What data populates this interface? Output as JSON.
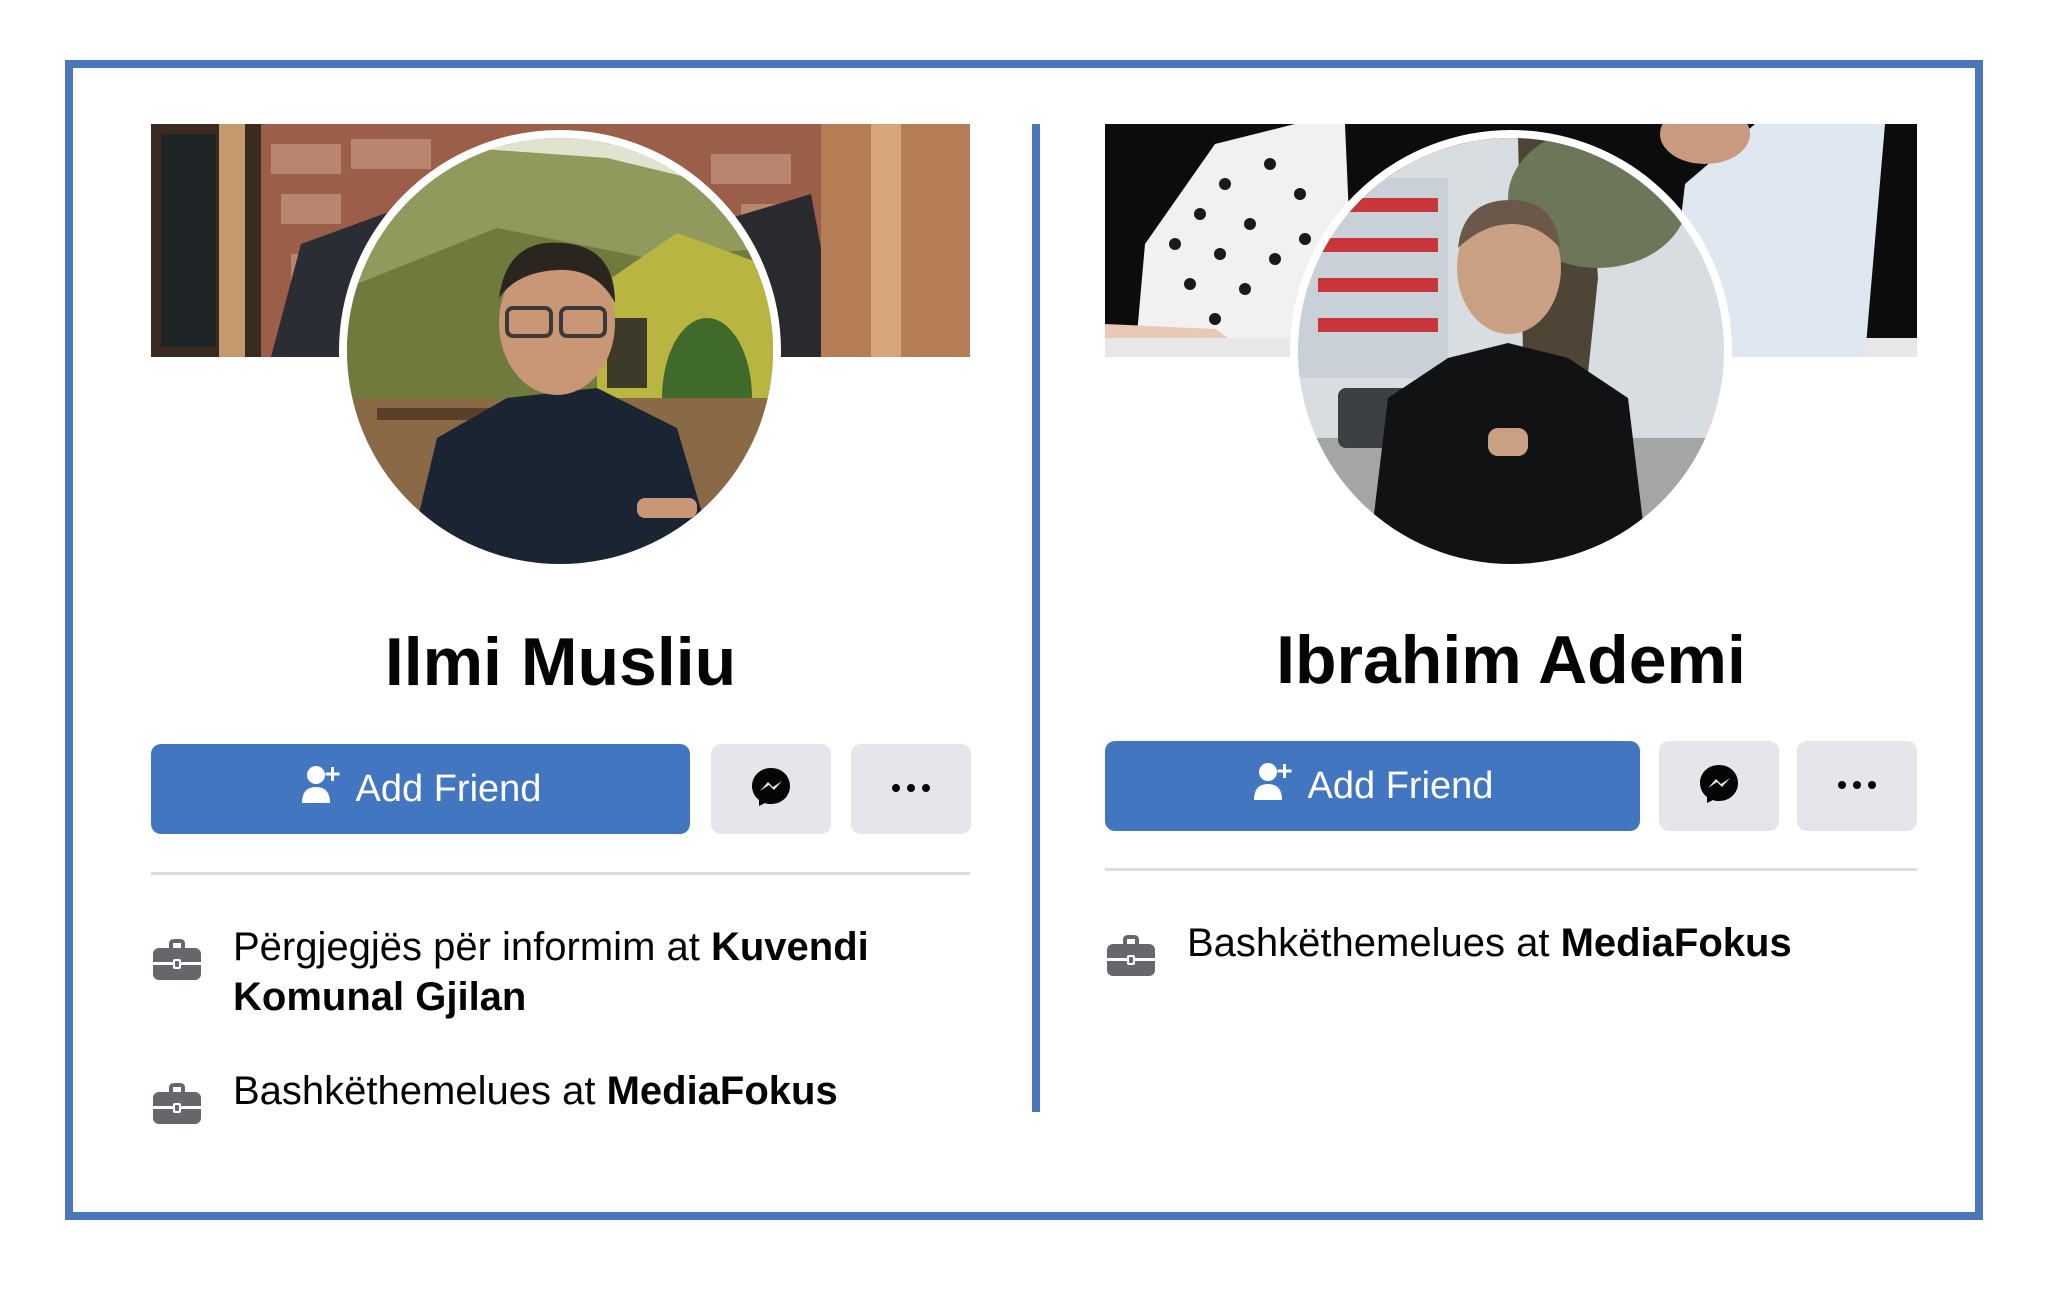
{
  "profiles": [
    {
      "name": "Ilmi Musliu",
      "add_friend_label": "Add Friend",
      "work": [
        {
          "prefix": "Përgjegjës për informim at ",
          "org": "Kuvendi Komunal Gjilan"
        },
        {
          "prefix": "Bashkëthemelues at ",
          "org": "MediaFokus"
        }
      ]
    },
    {
      "name": "Ibrahim Ademi",
      "add_friend_label": "Add Friend",
      "work": [
        {
          "prefix": "Bashkëthemelues at ",
          "org": "MediaFokus"
        }
      ]
    }
  ],
  "icons": {
    "add_friend": "person-add-icon",
    "messenger": "messenger-icon",
    "more": "more-horizontal-icon",
    "work": "briefcase-icon"
  },
  "colors": {
    "frame": "#4a77bb",
    "primary_button": "#4376c1",
    "secondary_button": "#e4e6eb"
  }
}
